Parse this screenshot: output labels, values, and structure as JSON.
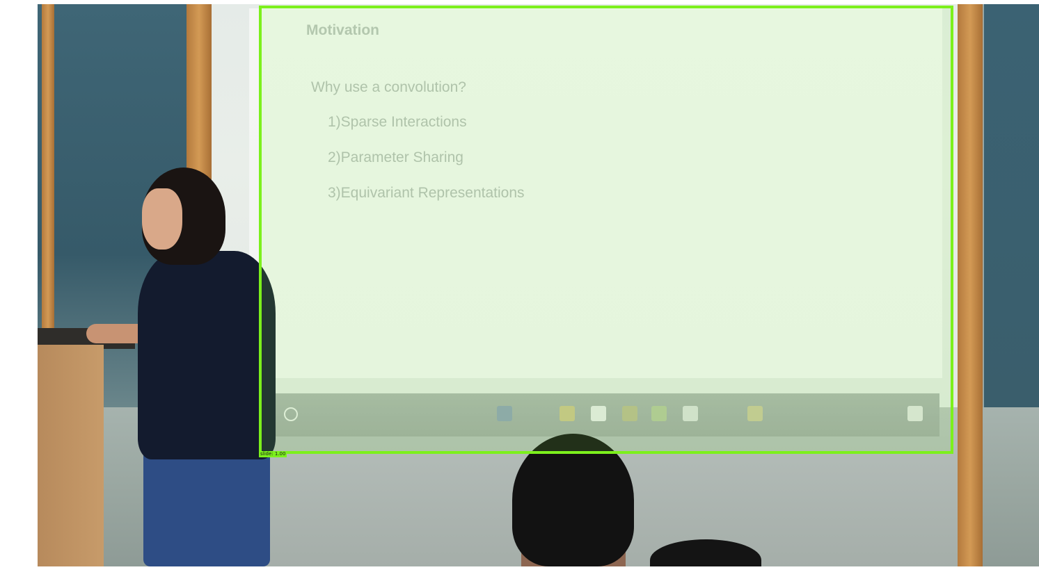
{
  "slide": {
    "title": "Motivation",
    "question": "Why use a convolution?",
    "items": [
      "1)Sparse Interactions",
      "2)Parameter Sharing",
      "3)Equivariant Representations"
    ]
  },
  "detection": {
    "label": "slide: 1.00",
    "color": "#7cf01c"
  }
}
